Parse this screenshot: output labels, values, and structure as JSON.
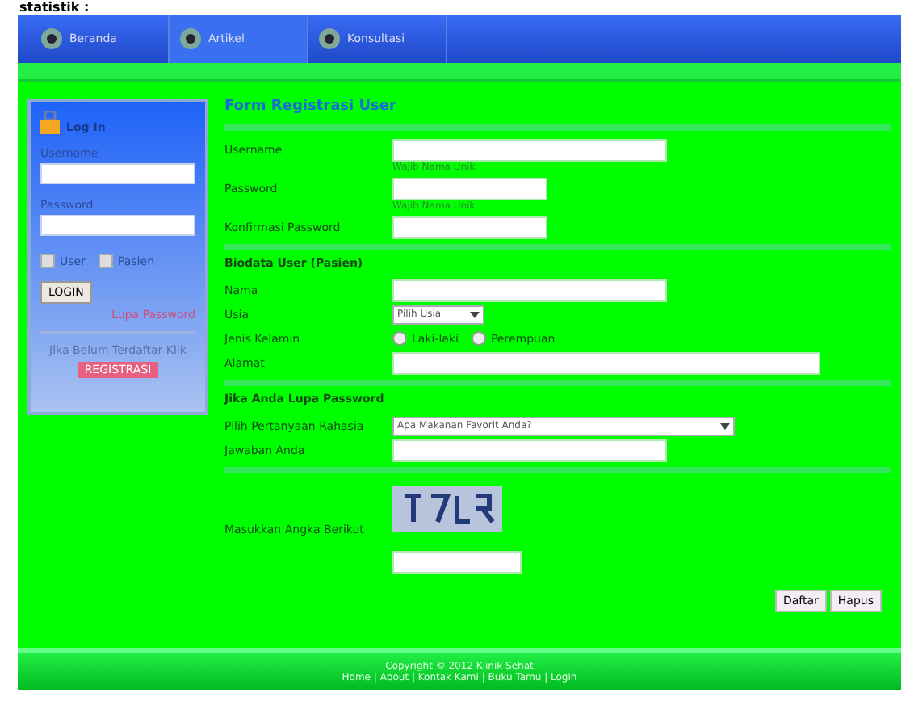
{
  "top_text": "statistik :",
  "nav": [
    {
      "label": "Beranda",
      "selected": false
    },
    {
      "label": "Artikel",
      "selected": true
    },
    {
      "label": "Konsultasi",
      "selected": false
    }
  ],
  "login": {
    "title": "Log In",
    "username_label": "Username",
    "password_label": "Password",
    "roles": [
      {
        "label": "User",
        "checked": false
      },
      {
        "label": "Pasien",
        "checked": false
      }
    ],
    "button": "LOGIN",
    "forgot": "Lupa Password",
    "register_text": "Jika Belum Terdaftar Klik",
    "register_link": "REGISTRASI"
  },
  "form": {
    "title": "Form Registrasi User",
    "sections": [
      {
        "rows": [
          {
            "kind": "text",
            "label": "Username",
            "hint": "Wajib Nama Unik"
          },
          {
            "kind": "text",
            "label": "Password",
            "hint": "Wajib Nama Unik"
          },
          {
            "kind": "text",
            "label": "Konfirmasi Password"
          }
        ]
      },
      {
        "title": "Biodata User (Pasien)",
        "rows": [
          {
            "kind": "text",
            "label": "Nama"
          },
          {
            "kind": "select",
            "label": "Usia",
            "value": "Pilih Usia"
          },
          {
            "kind": "radio",
            "label": "Jenis Kelamin",
            "options": [
              {
                "label": "Laki-laki",
                "selected": false
              },
              {
                "label": "Perempuan",
                "selected": false
              }
            ]
          },
          {
            "kind": "text",
            "label": "Alamat"
          }
        ]
      },
      {
        "title": "Jika Anda Lupa Password",
        "rows": [
          {
            "kind": "select",
            "label": "Pilih Pertanyaan Rahasia",
            "value": "Apa Makanan Favorit Anda?"
          },
          {
            "kind": "text",
            "label": "Jawaban Anda"
          }
        ]
      },
      {
        "rows": [
          {
            "kind": "captcha",
            "label": "Masukkan Angka Berikut"
          }
        ]
      }
    ],
    "buttons": [
      "Daftar",
      "Hapus"
    ]
  },
  "footer": [
    "Copyright © 2012 Klinik Sehat",
    "Home | About | Kontak Kami | Buku Tamu | Login"
  ]
}
